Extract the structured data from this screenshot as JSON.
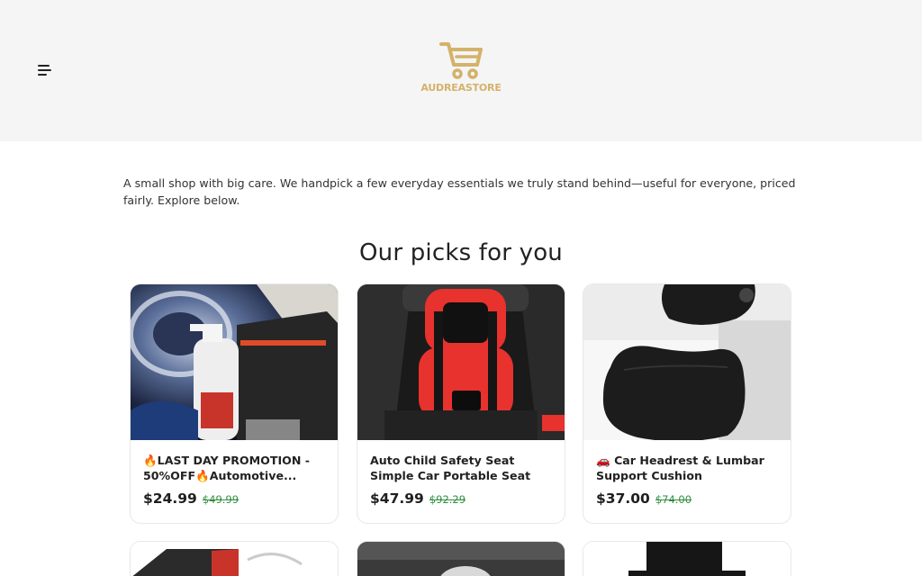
{
  "header": {
    "menu_icon": "hamburger-menu-icon",
    "logo_icon": "shopping-cart-icon",
    "logo_text": "AUDREASTORE",
    "brand_color": "#d4b26a"
  },
  "intro": {
    "text": "A small shop with big care. We handpick a few everyday essentials we truly stand behind—useful for everyone, priced fairly. Explore below."
  },
  "section": {
    "title": "Our picks for you"
  },
  "products": [
    {
      "name": "🔥LAST DAY PROMOTION - 50%OFF🔥Automotive...",
      "price": "$24.99",
      "compare_price": "$49.99"
    },
    {
      "name": "Auto Child Safety Seat Simple Car Portable Seat Belt",
      "price": "$47.99",
      "compare_price": "$92.29"
    },
    {
      "name": "🚗 Car Headrest & Lumbar Support Cushion",
      "price": "$37.00",
      "compare_price": "$74.00"
    }
  ],
  "colors": {
    "header_bg": "#f5f5f5",
    "compare_price": "#2f8f3f"
  }
}
